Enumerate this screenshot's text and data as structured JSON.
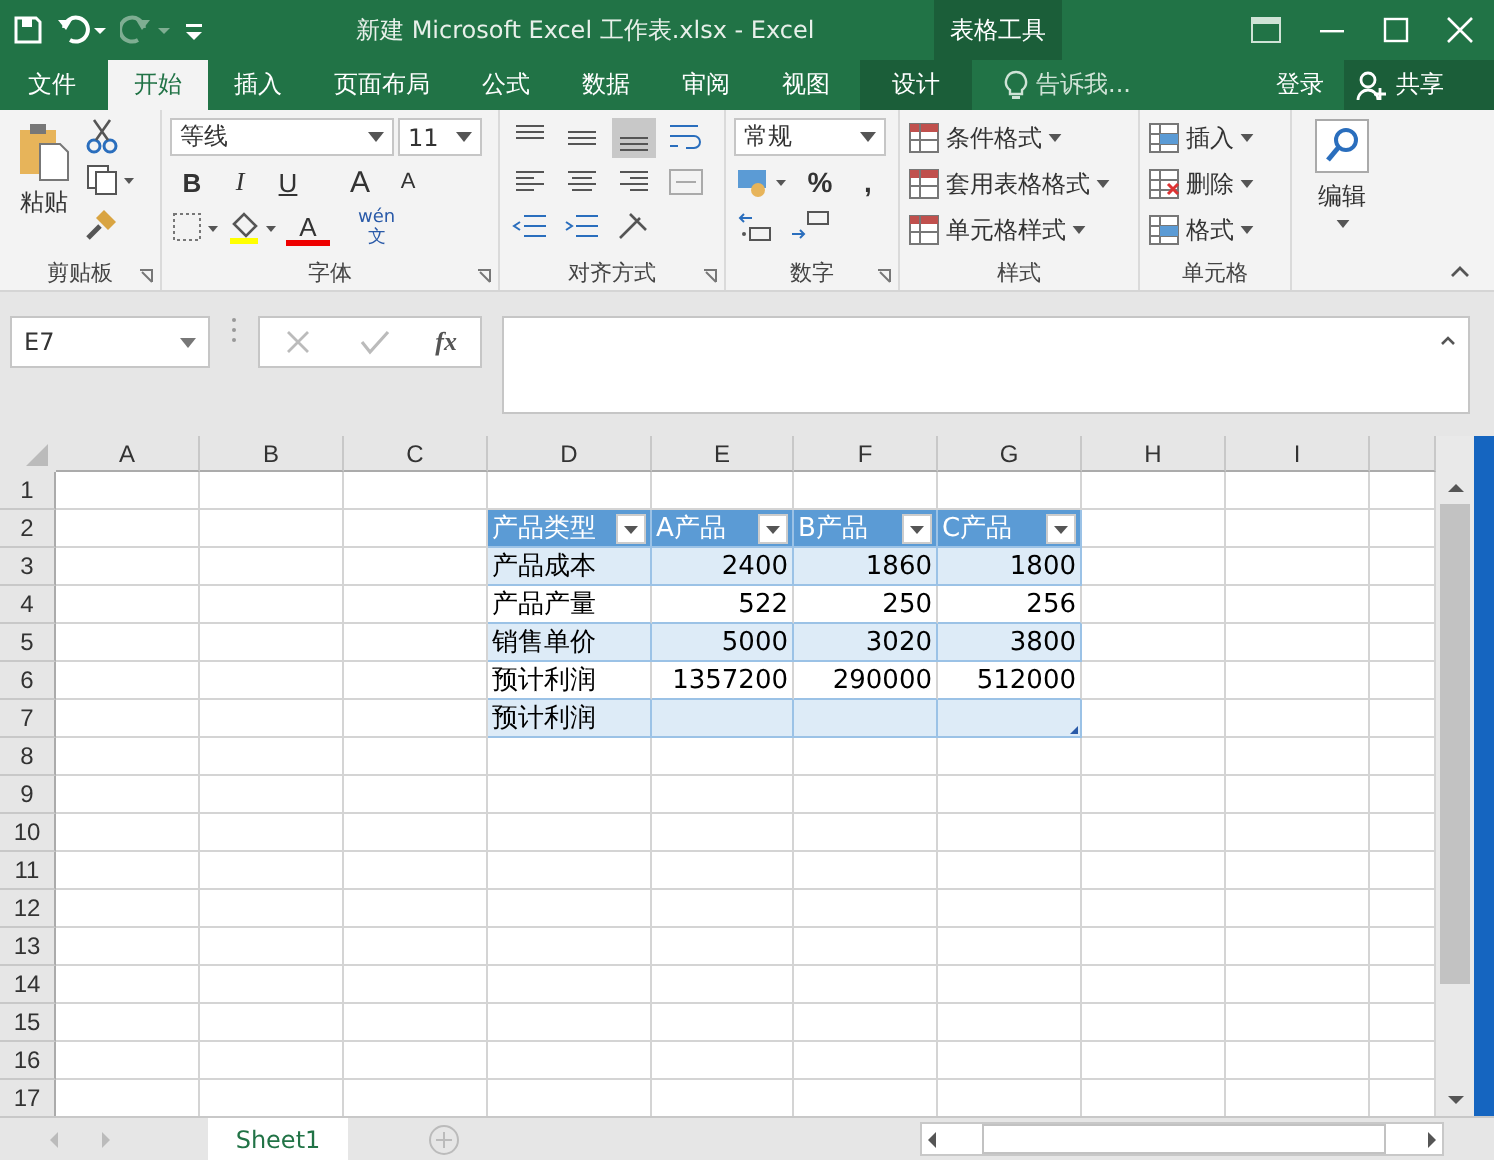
{
  "title_bar": {
    "title": "新建 Microsoft Excel 工作表.xlsx - Excel",
    "context_label": "表格工具"
  },
  "tabs": [
    {
      "label": "文件",
      "selected": false,
      "kind": "file"
    },
    {
      "label": "开始",
      "selected": true,
      "kind": "normal"
    },
    {
      "label": "插入",
      "selected": false,
      "kind": "normal"
    },
    {
      "label": "页面布局",
      "selected": false,
      "kind": "normal"
    },
    {
      "label": "公式",
      "selected": false,
      "kind": "normal"
    },
    {
      "label": "数据",
      "selected": false,
      "kind": "normal"
    },
    {
      "label": "审阅",
      "selected": false,
      "kind": "normal"
    },
    {
      "label": "视图",
      "selected": false,
      "kind": "normal"
    },
    {
      "label": "设计",
      "selected": false,
      "kind": "contextual"
    }
  ],
  "tell_me": "告诉我...",
  "sign_in": "登录",
  "share": "共享",
  "ribbon": {
    "clipboard": {
      "paste": "粘贴",
      "label": "剪贴板"
    },
    "font": {
      "font_name": "等线",
      "font_size": "11",
      "bold": "B",
      "italic": "I",
      "underline": "U",
      "grow": "A",
      "shrink": "A",
      "font_color": "A",
      "phonetic_top": "wén",
      "phonetic_bottom": "文",
      "label": "字体"
    },
    "alignment": {
      "label": "对齐方式"
    },
    "number": {
      "format": "常规",
      "percent": "%",
      "comma": ",",
      "label": "数字"
    },
    "styles": {
      "items": [
        "条件格式",
        "套用表格格式",
        "单元格样式"
      ],
      "label": "样式"
    },
    "cells": {
      "items": [
        "插入",
        "删除",
        "格式"
      ],
      "label": "单元格"
    },
    "editing": {
      "label": "编辑"
    }
  },
  "formula_bar": {
    "name_box": "E7",
    "fx": "fx"
  },
  "columns": [
    "A",
    "B",
    "C",
    "D",
    "E",
    "F",
    "G",
    "H",
    "I"
  ],
  "row_numbers": [
    "1",
    "2",
    "3",
    "4",
    "5",
    "6",
    "7",
    "8",
    "9",
    "10",
    "11",
    "12",
    "13",
    "14",
    "15",
    "16",
    "17"
  ],
  "table": {
    "header": [
      "产品类型",
      "A产品",
      "B产品",
      "C产品"
    ],
    "rows": [
      [
        "产品成本",
        "2400",
        "1860",
        "1800"
      ],
      [
        "产品产量",
        "522",
        "250",
        "256"
      ],
      [
        "销售单价",
        "5000",
        "3020",
        "3800"
      ],
      [
        "预计利润",
        "1357200",
        "290000",
        "512000"
      ],
      [
        "预计利润"
      ]
    ]
  },
  "sheet_tabs": [
    {
      "label": "Sheet1",
      "selected": true
    }
  ]
}
